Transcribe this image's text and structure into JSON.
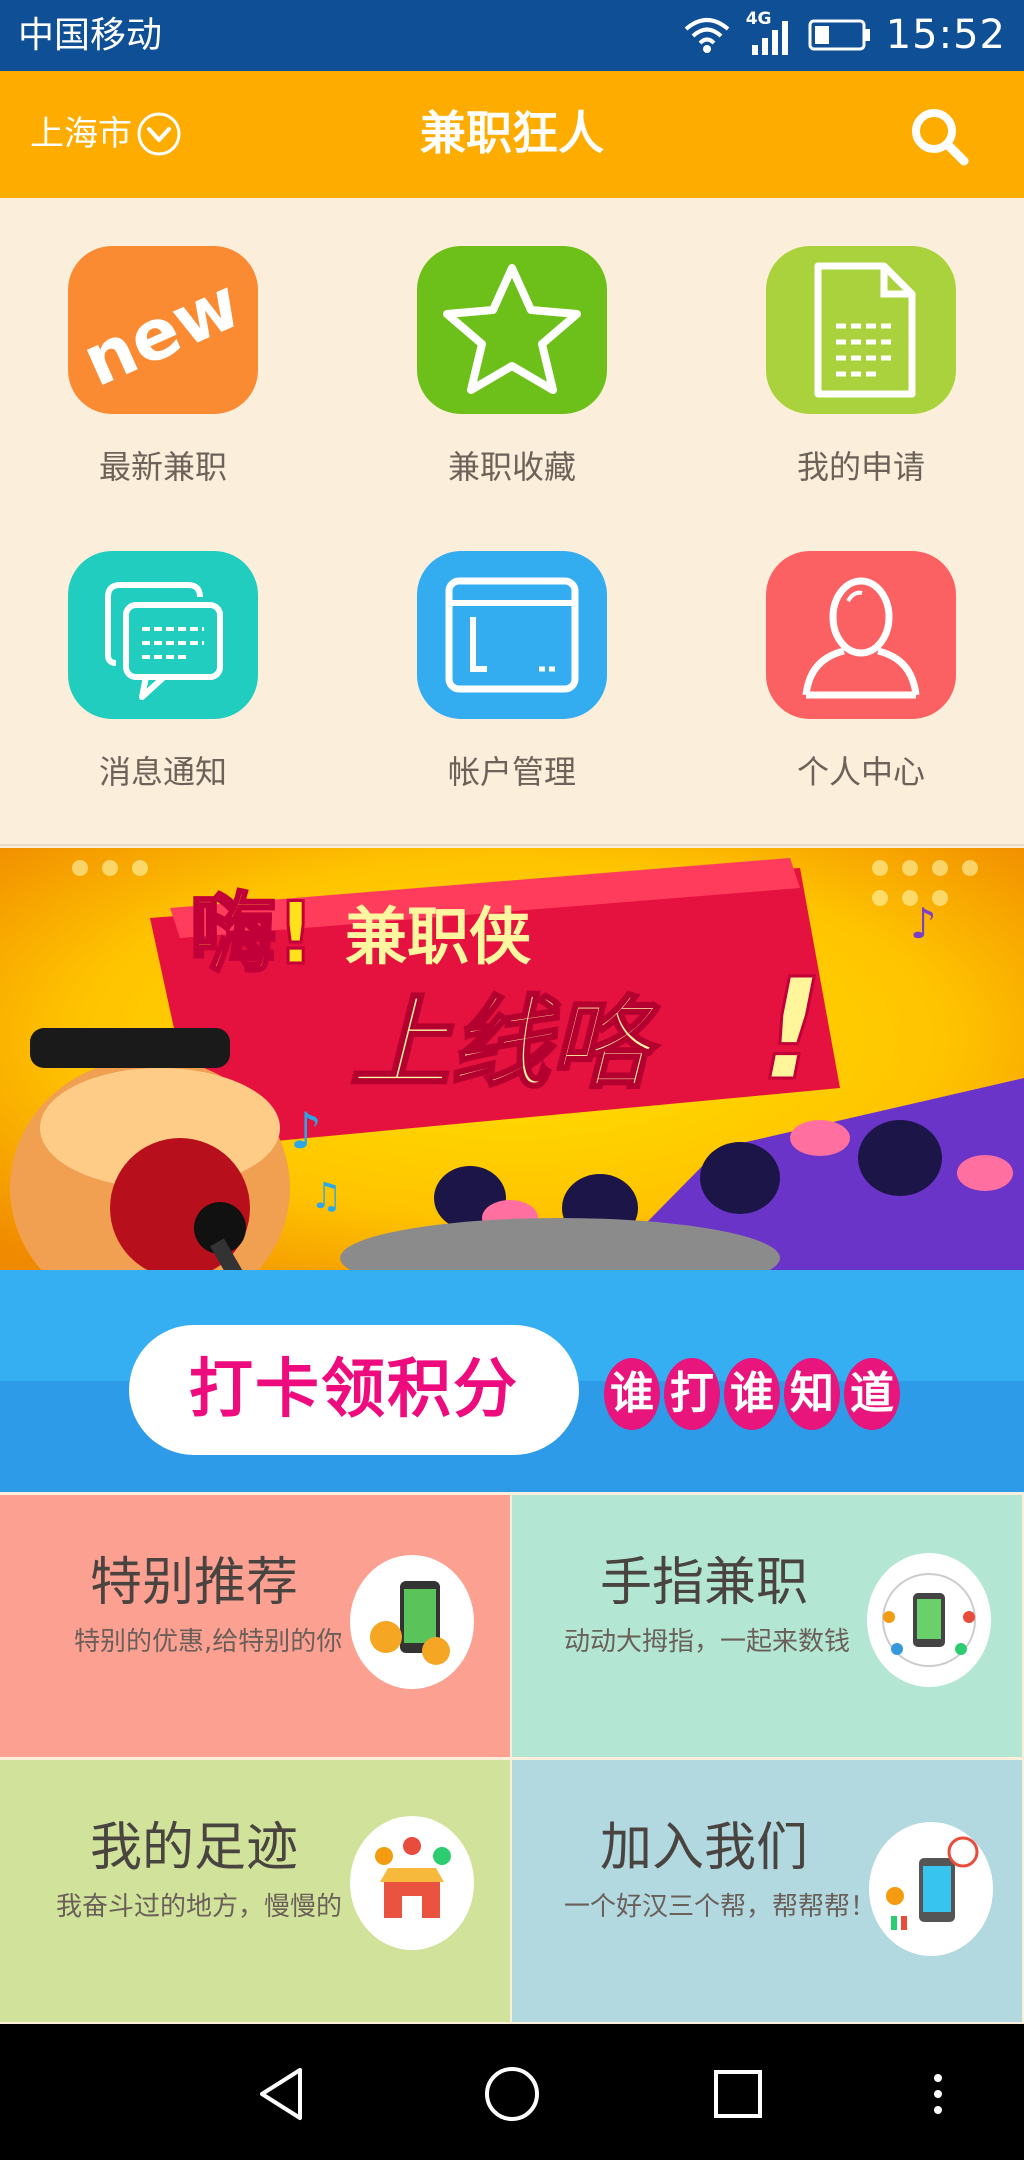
{
  "status_bar": {
    "carrier": "中国移动",
    "network": "4G",
    "time": "15:52",
    "icons": [
      "wifi-icon",
      "signal-icon",
      "battery-icon"
    ]
  },
  "header": {
    "city": "上海市",
    "title": "兼职狂人",
    "icons": [
      "chevron-down-icon",
      "search-icon"
    ],
    "color": "#ffac00"
  },
  "menu": [
    {
      "label": "最新兼职",
      "icon": "new-icon",
      "color": "#fb8b33"
    },
    {
      "label": "兼职收藏",
      "icon": "star-icon",
      "color": "#6cc019"
    },
    {
      "label": "我的申请",
      "icon": "document-icon",
      "color": "#a9d23c"
    },
    {
      "label": "消息通知",
      "icon": "message-icon",
      "color": "#20cdbf"
    },
    {
      "label": "帐户管理",
      "icon": "wallet-icon",
      "color": "#33acf0"
    },
    {
      "label": "个人中心",
      "icon": "person-icon",
      "color": "#fb6062"
    }
  ],
  "banner": {
    "line1": "嗨!",
    "line2": "兼职侠",
    "line3": "上线咯",
    "mark": "!"
  },
  "checkin": {
    "button": "打卡领积分",
    "tagline": [
      "谁",
      "打",
      "谁",
      "知",
      "道"
    ]
  },
  "cards": [
    {
      "title": "特别推荐",
      "subtitle": "特别的优惠,给特别的你",
      "icon": "phone-money-icon",
      "color": "#fca092"
    },
    {
      "title": "手指兼职",
      "subtitle": "动动大拇指，一起来数钱",
      "icon": "phone-people-icon",
      "color": "#b3e6d3"
    },
    {
      "title": "我的足迹",
      "subtitle": "我奋斗过的地方，慢慢的",
      "icon": "shop-icon",
      "color": "#d1e39b"
    },
    {
      "title": "加入我们",
      "subtitle": "一个好汉三个帮，帮帮帮！",
      "icon": "atm-phone-icon",
      "color": "#b2d8e0"
    }
  ],
  "nav": {
    "icons": [
      "back-icon",
      "home-icon",
      "recents-icon",
      "more-icon"
    ]
  }
}
